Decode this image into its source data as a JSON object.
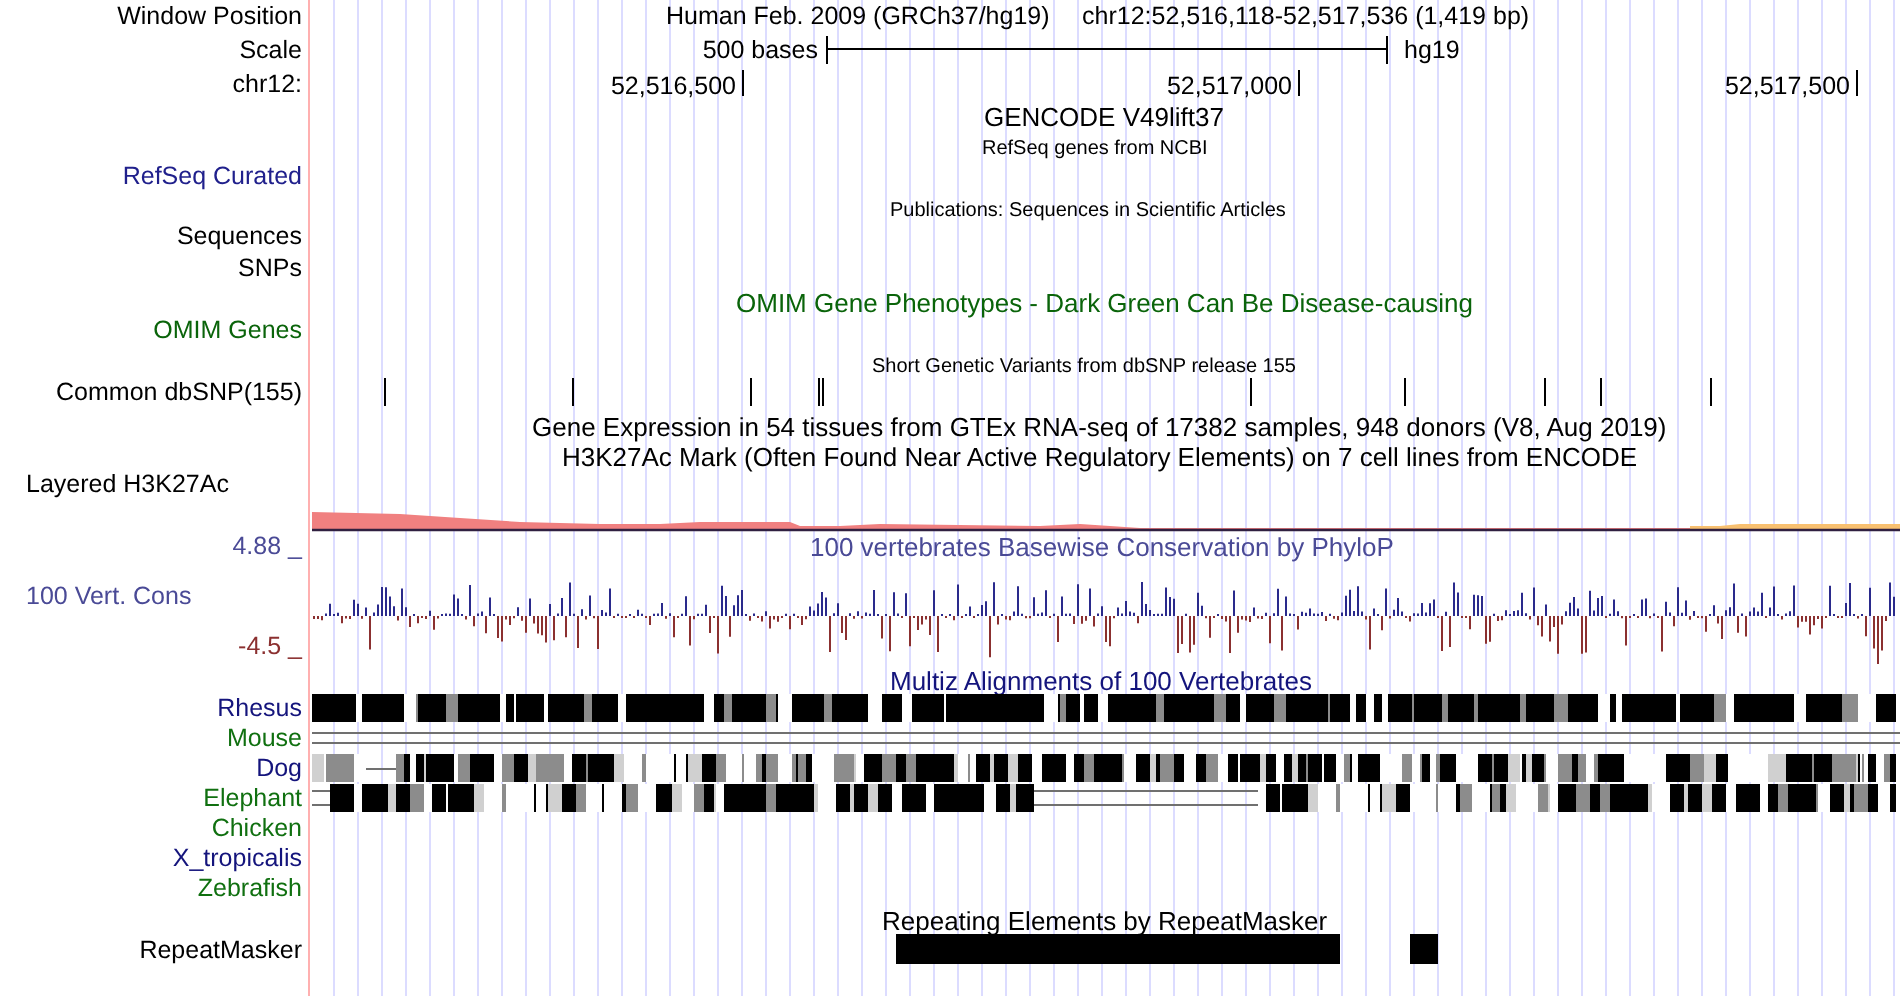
{
  "header": {
    "assembly": "Human Feb. 2009 (GRCh37/hg19)",
    "position": "chr12:52,516,118-52,517,536 (1,419 bp)"
  },
  "scale": {
    "label": "500 bases",
    "assembly": "hg19"
  },
  "ruler": {
    "ticks": [
      "52,516,500",
      "52,517,000",
      "52,517,500"
    ]
  },
  "track_labels": [
    {
      "text": "Window Position",
      "color": "#000000"
    },
    {
      "text": "Scale",
      "color": "#000000"
    },
    {
      "text": "chr12:",
      "color": "#000000"
    },
    {
      "text": "RefSeq Curated",
      "color": "#20208c"
    },
    {
      "text": "Sequences",
      "color": "#000000"
    },
    {
      "text": "SNPs",
      "color": "#000000"
    },
    {
      "text": "OMIM Genes",
      "color": "#0a640a"
    },
    {
      "text": "Common dbSNP(155)",
      "color": "#000000"
    },
    {
      "text": "Layered H3K27Ac",
      "color": "#000000"
    },
    {
      "text": "4.88 _",
      "color": "#4a4a96"
    },
    {
      "text": "100 Vert. Cons",
      "color": "#4a4a96"
    },
    {
      "text": "-4.5 _",
      "color": "#8b3030"
    },
    {
      "text": "Rhesus",
      "color": "#14147c"
    },
    {
      "text": "Mouse",
      "color": "#107010"
    },
    {
      "text": "Dog",
      "color": "#14147c"
    },
    {
      "text": "Elephant",
      "color": "#107010"
    },
    {
      "text": "Chicken",
      "color": "#107010"
    },
    {
      "text": "X_tropicalis",
      "color": "#14147c"
    },
    {
      "text": "Zebrafish",
      "color": "#107010"
    },
    {
      "text": "RepeatMasker",
      "color": "#000000"
    }
  ],
  "track_titles": [
    {
      "text": "GENCODE V49lift37",
      "color": "#000000"
    },
    {
      "text": "RefSeq genes from NCBI",
      "color": "#000000"
    },
    {
      "text": "Publications: Sequences in Scientific Articles",
      "color": "#000000"
    },
    {
      "text": "OMIM Gene Phenotypes - Dark Green Can Be Disease-causing",
      "color": "#0a640a"
    },
    {
      "text": "Short Genetic Variants from dbSNP release 155",
      "color": "#000000"
    },
    {
      "text": "Gene Expression in 54 tissues from GTEx RNA-seq of 17382 samples, 948 donors (V8, Aug 2019)",
      "color": "#000000"
    },
    {
      "text": "H3K27Ac Mark (Often Found Near Active Regulatory Elements) on 7 cell lines from ENCODE",
      "color": "#000000"
    },
    {
      "text": "100 vertebrates Basewise Conservation by PhyloP",
      "color": "#4a4a96"
    },
    {
      "text": "Multiz Alignments of 100 Vertebrates",
      "color": "#14147c"
    },
    {
      "text": "Repeating Elements by RepeatMasker",
      "color": "#000000"
    }
  ]
}
